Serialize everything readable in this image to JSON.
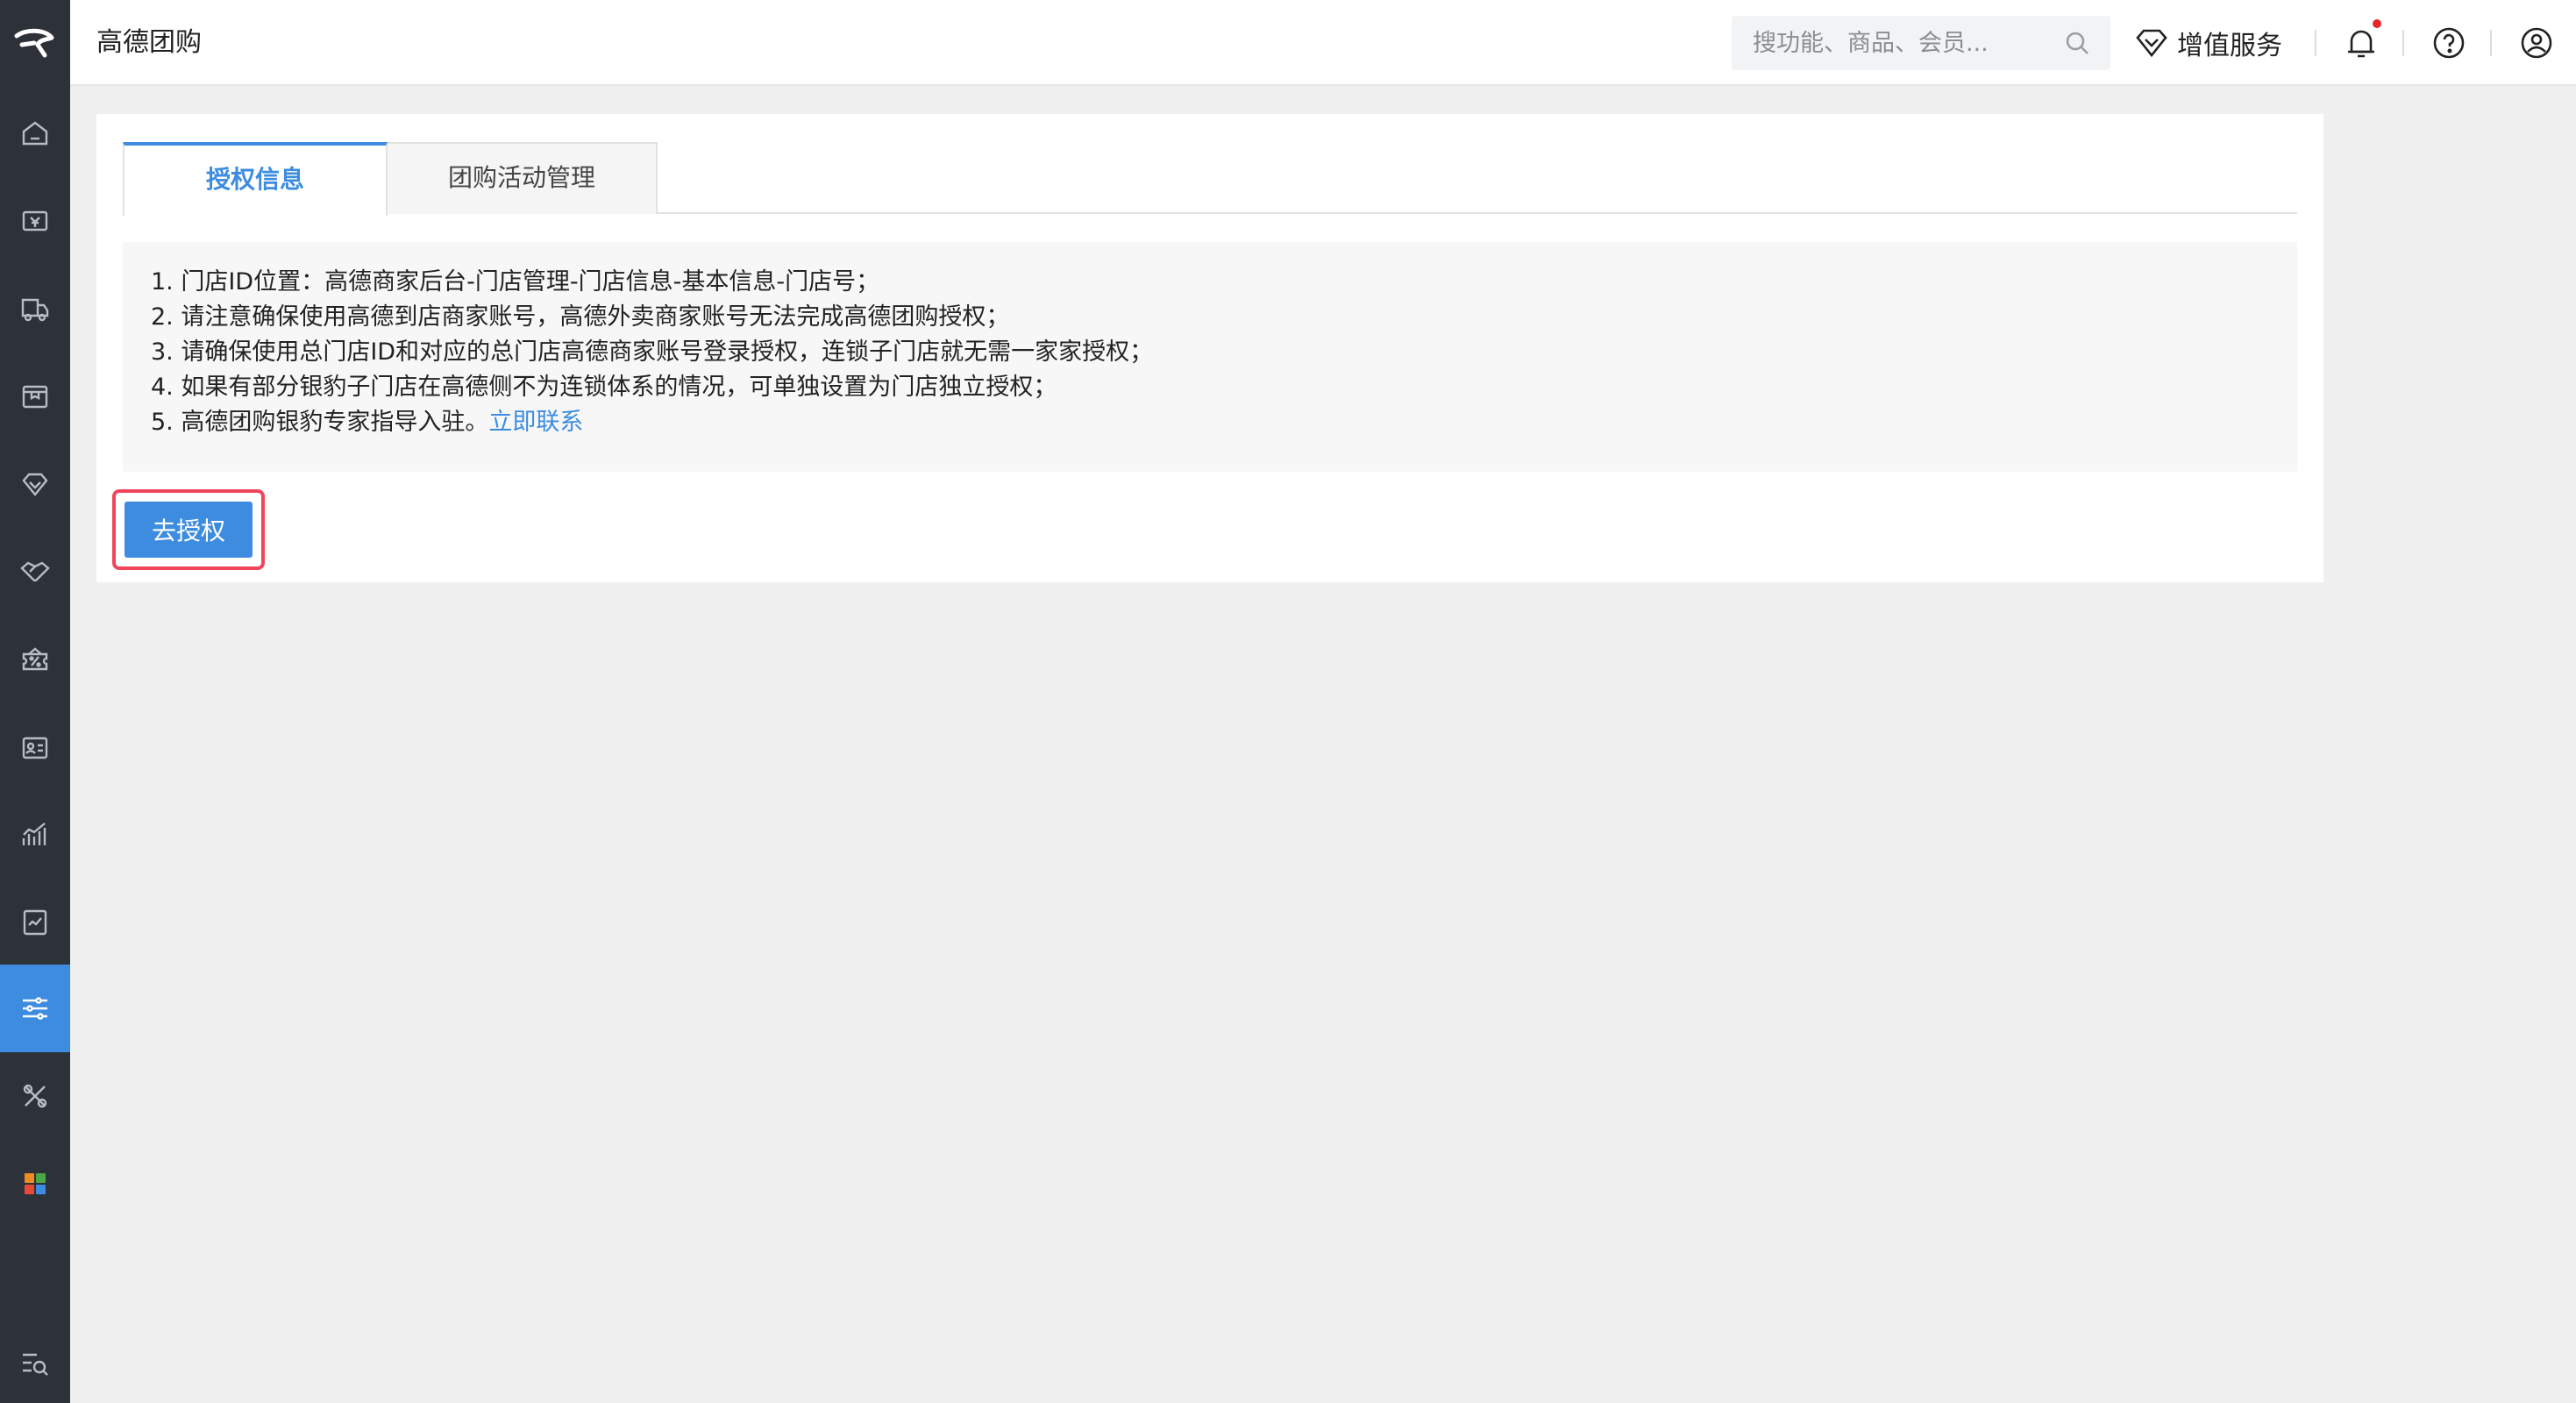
{
  "app": {
    "title": "高德团购"
  },
  "search": {
    "placeholder": "搜功能、商品、会员..."
  },
  "header": {
    "vas_label": "增值服务"
  },
  "tabs": [
    {
      "label": "授权信息",
      "active": true
    },
    {
      "label": "团购活动管理",
      "active": false
    }
  ],
  "notice": {
    "lines": [
      "1. 门店ID位置：高德商家后台-门店管理-门店信息-基本信息-门店号；",
      "2. 请注意确保使用高德到店商家账号，高德外卖商家账号无法完成高德团购授权；",
      "3. 请确保使用总门店ID和对应的总门店高德商家账号登录授权，连锁子门店就无需一家家授权；",
      "4. 如果有部分银豹子门店在高德侧不为连锁体系的情况，可单独设置为门店独立授权；",
      "5. 高德团购银豹专家指导入驻。"
    ],
    "contact_link": "立即联系"
  },
  "actions": {
    "authorize_label": "去授权"
  },
  "sidebar": {
    "items": [
      {
        "icon": "home-icon"
      },
      {
        "icon": "cash-register-icon"
      },
      {
        "icon": "delivery-truck-icon"
      },
      {
        "icon": "product-box-icon"
      },
      {
        "icon": "member-diamond-icon"
      },
      {
        "icon": "handshake-icon"
      },
      {
        "icon": "promotion-ticket-icon"
      },
      {
        "icon": "employee-card-icon"
      },
      {
        "icon": "report-chart-icon"
      },
      {
        "icon": "document-check-icon"
      },
      {
        "icon": "settings-sliders-icon",
        "active": true
      },
      {
        "icon": "tools-icon"
      },
      {
        "icon": "apps-grid-icon"
      }
    ],
    "bottom_icon": "menu-search-icon"
  },
  "colors": {
    "accent": "#3d8ce0",
    "sidebar_bg": "#2d3138",
    "highlight_border": "#f0465b",
    "notification_dot": "#e5252b"
  }
}
